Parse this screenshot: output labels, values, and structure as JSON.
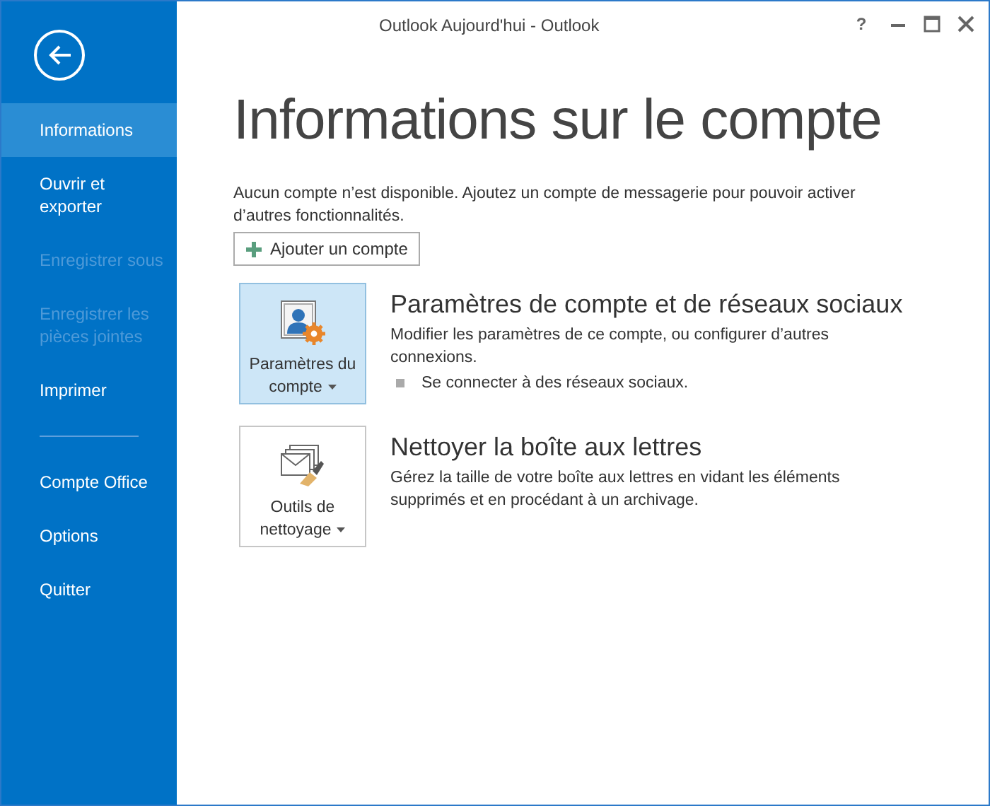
{
  "window": {
    "title": "Outlook Aujourd'hui - Outlook",
    "help": "?"
  },
  "sidebar": {
    "items": [
      {
        "label": "Informations",
        "selected": true,
        "disabled": false
      },
      {
        "label": "Ouvrir et exporter",
        "selected": false,
        "disabled": false
      },
      {
        "label": "Enregistrer sous",
        "selected": false,
        "disabled": true
      },
      {
        "label": "Enregistrer les pièces jointes",
        "selected": false,
        "disabled": true
      },
      {
        "label": "Imprimer",
        "selected": false,
        "disabled": false
      },
      {
        "kind": "divider"
      },
      {
        "label": "Compte Office",
        "selected": false,
        "disabled": false
      },
      {
        "label": "Options",
        "selected": false,
        "disabled": false
      },
      {
        "label": "Quitter",
        "selected": false,
        "disabled": false
      }
    ]
  },
  "page": {
    "title": "Informations sur le compte",
    "description": "Aucun compte n’est disponible. Ajoutez un compte de messagerie pour pouvoir activer d’autres fonctionnalités.",
    "add_button": "Ajouter un compte"
  },
  "sections": [
    {
      "kind": "account",
      "button": "Paramètres du compte",
      "selected": true,
      "heading": "Paramètres de compte et de réseaux sociaux",
      "text": "Modifier les paramètres de ce compte, ou configurer d’autres connexions.",
      "bullets": [
        "Se connecter à des réseaux sociaux."
      ]
    },
    {
      "kind": "cleanup",
      "button": "Outils de nettoyage",
      "selected": false,
      "heading": "Nettoyer la boîte aux lettres",
      "text": "Gérez la taille de votre boîte aux lettres en vidant les éléments supprimés et en procédant à un archivage."
    }
  ]
}
